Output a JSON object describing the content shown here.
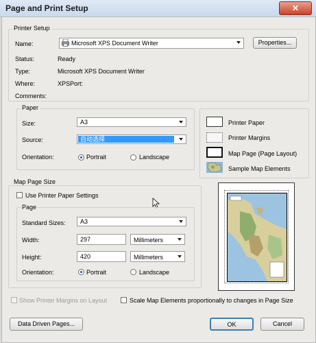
{
  "window": {
    "title": "Page and Print Setup",
    "close_glyph": "✕"
  },
  "printer_setup": {
    "group_title": "Printer Setup",
    "name_label": "Name:",
    "name_value": "Microsoft XPS Document Writer",
    "properties_button": "Properties...",
    "status_label": "Status:",
    "status_value": "Ready",
    "type_label": "Type:",
    "type_value": "Microsoft XPS Document Writer",
    "where_label": "Where:",
    "where_value": "XPSPort:",
    "comments_label": "Comments:"
  },
  "paper": {
    "group_title": "Paper",
    "size_label": "Size:",
    "size_value": "A3",
    "source_label": "Source:",
    "source_value": "自动选择",
    "orientation_label": "Orientation:",
    "portrait_label": "Portrait",
    "landscape_label": "Landscape",
    "selected": "portrait"
  },
  "legend": {
    "items": [
      {
        "label": "Printer Paper",
        "icon": "paper-rect-icon"
      },
      {
        "label": "Printer Margins",
        "icon": "margins-dotted-icon"
      },
      {
        "label": "Map Page (Page Layout)",
        "icon": "map-page-rect-icon"
      },
      {
        "label": "Sample Map Elements",
        "icon": "sample-map-icon"
      }
    ]
  },
  "map_page_size": {
    "group_title": "Map Page Size",
    "use_printer_label": "Use Printer Paper Settings",
    "use_printer_checked": false,
    "page": {
      "group_title": "Page",
      "standard_sizes_label": "Standard Sizes:",
      "standard_sizes_value": "A3",
      "width_label": "Width:",
      "width_value": "297",
      "width_units": "Millimeters",
      "height_label": "Height:",
      "height_value": "420",
      "height_units": "Millimeters",
      "orientation_label": "Orientation:",
      "portrait_label": "Portrait",
      "landscape_label": "Landscape",
      "selected": "portrait"
    }
  },
  "options": {
    "show_margins_label": "Show Printer Margins on Layout",
    "scale_elements_label": "Scale Map Elements proportionally to changes in Page Size"
  },
  "buttons": {
    "data_driven_pages": "Data Driven Pages...",
    "ok": "OK",
    "cancel": "Cancel"
  },
  "colors": {
    "selection_blue": "#3399ff",
    "title_bar": "#c9d9ee"
  }
}
